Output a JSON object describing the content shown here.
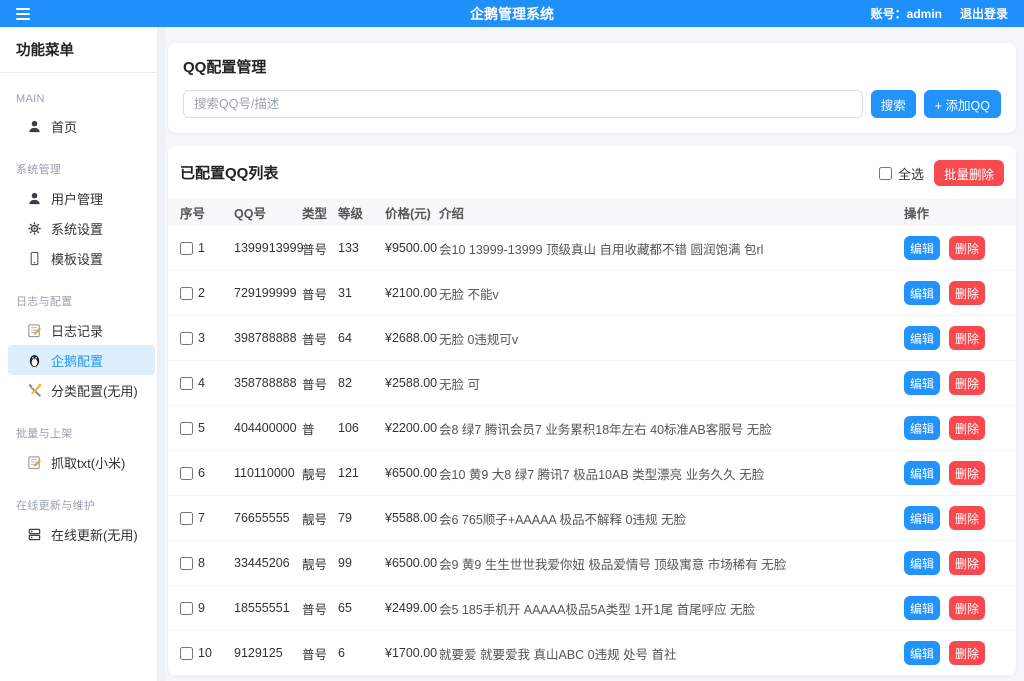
{
  "header": {
    "title": "企鹅管理系统",
    "account_label": "账号：admin",
    "logout_label": "退出登录"
  },
  "sidebar": {
    "title": "功能菜单",
    "sections": [
      {
        "label": "MAIN",
        "items": [
          {
            "label": "首页",
            "icon": "user-icon",
            "active": false
          }
        ]
      },
      {
        "label": "系统管理",
        "items": [
          {
            "label": "用户管理",
            "icon": "user-icon",
            "active": false
          },
          {
            "label": "系统设置",
            "icon": "gear-icon",
            "active": false
          },
          {
            "label": "模板设置",
            "icon": "tablet-icon",
            "active": false
          }
        ]
      },
      {
        "label": "日志与配置",
        "items": [
          {
            "label": "日志记录",
            "icon": "memo-icon",
            "active": false
          },
          {
            "label": "企鹅配置",
            "icon": "penguin-icon",
            "active": true
          },
          {
            "label": "分类配置(无用)",
            "icon": "tools-icon",
            "active": false
          }
        ]
      },
      {
        "label": "批量与上架",
        "items": [
          {
            "label": "抓取txt(小米)",
            "icon": "memo-icon",
            "active": false
          }
        ]
      },
      {
        "label": "在线更新与维护",
        "items": [
          {
            "label": "在线更新(无用)",
            "icon": "server-icon",
            "active": false
          }
        ]
      }
    ]
  },
  "manage_card": {
    "title": "QQ配置管理",
    "search_placeholder": "搜索QQ号/描述",
    "search_value": "",
    "search_button": "搜索",
    "add_button": "+ 添加QQ"
  },
  "list_card": {
    "title": "已配置QQ列表",
    "select_all_label": "全选",
    "batch_delete_button": "批量删除",
    "table": {
      "headers": [
        "序号",
        "QQ号",
        "类型",
        "等级",
        "价格(元)",
        "介绍",
        "操作"
      ],
      "edit_button": "编辑",
      "delete_button": "删除",
      "rows": [
        {
          "index": "1",
          "qq": "1399913999",
          "type": "普号",
          "level": "133",
          "price": "¥9500.00",
          "desc": "会10 13999-13999 顶级真山 自用收藏都不错 圆润饱满 包rl"
        },
        {
          "index": "2",
          "qq": "729199999",
          "type": "普号",
          "level": "31",
          "price": "¥2100.00",
          "desc": "无脸 不能v"
        },
        {
          "index": "3",
          "qq": "398788888",
          "type": "普号",
          "level": "64",
          "price": "¥2688.00",
          "desc": "无脸 0违规可v"
        },
        {
          "index": "4",
          "qq": "358788888",
          "type": "普号",
          "level": "82",
          "price": "¥2588.00",
          "desc": "无脸 可"
        },
        {
          "index": "5",
          "qq": "404400000",
          "type": "普",
          "level": "106",
          "price": "¥2200.00",
          "desc": "会8 绿7 腾讯会员7 业务累积18年左右 40标准AB客服号 无脸"
        },
        {
          "index": "6",
          "qq": "110110000",
          "type": "靓号",
          "level": "121",
          "price": "¥6500.00",
          "desc": "会10 黄9 大8 绿7 腾讯7 极品10AB 类型漂亮 业务久久 无脸"
        },
        {
          "index": "7",
          "qq": "76655555",
          "type": "靓号",
          "level": "79",
          "price": "¥5588.00",
          "desc": "会6 765顺子+AAAAA 极品不解释 0违规 无脸"
        },
        {
          "index": "8",
          "qq": "33445206",
          "type": "靓号",
          "level": "99",
          "price": "¥6500.00",
          "desc": "会9 黄9 生生世世我爱你妞 极品爱情号 顶级寓意 市场稀有 无脸"
        },
        {
          "index": "9",
          "qq": "18555551",
          "type": "普号",
          "level": "65",
          "price": "¥2499.00",
          "desc": "会5 185手机开 AAAAA极品5A类型 1开1尾 首尾呼应 无脸"
        },
        {
          "index": "10",
          "qq": "9129125",
          "type": "普号",
          "level": "6",
          "price": "¥1700.00",
          "desc": "就要爱 就要爱我 真山ABC 0违规 处号 首社"
        }
      ]
    }
  },
  "colors": {
    "primary": "#2193fa",
    "danger": "#f8494e",
    "header_bg": "#1f8ffb",
    "active_bg": "#ddeefc",
    "active_text": "#2196f3",
    "content_bg": "#f4f6fa"
  }
}
